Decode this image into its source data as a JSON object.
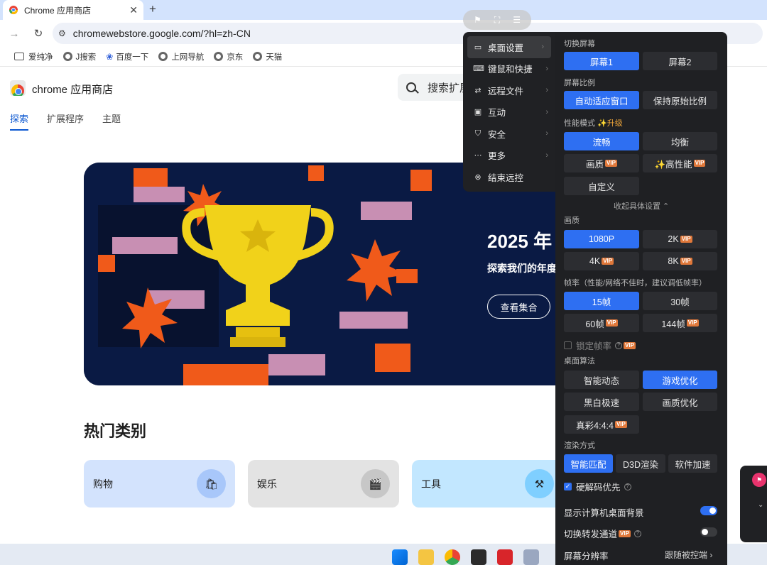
{
  "browser": {
    "tab_title": "Chrome 应用商店",
    "tab_close": "✕",
    "new_tab": "+",
    "url": "chromewebstore.google.com/?hl=zh-CN",
    "bookmarks": [
      "爱纯净",
      "J搜索",
      "百度一下",
      "上网导航",
      "京东",
      "天猫"
    ]
  },
  "store": {
    "name": "chrome 应用商店",
    "search_placeholder": "搜索扩展",
    "nav_tabs": [
      "探索",
      "扩展程序",
      "主题"
    ],
    "hero": {
      "title": "2025 年",
      "subtitle": "探索我们的年度",
      "button": "查看集合"
    },
    "categories_title": "热门类别",
    "categories": [
      {
        "label": "购物",
        "bg": "#d3e3fd",
        "icon_bg": "#a8c7fa",
        "icon": "🛍"
      },
      {
        "label": "娱乐",
        "bg": "#e3e3e3",
        "icon_bg": "#c7c7c7",
        "icon": "🎬"
      },
      {
        "label": "工具",
        "bg": "#c2e7ff",
        "icon_bg": "#7fcfff",
        "icon": "⚒"
      }
    ]
  },
  "remote_menu": {
    "items": [
      {
        "label": "桌面设置",
        "icon": "▭"
      },
      {
        "label": "键鼠和快捷",
        "icon": "⌨"
      },
      {
        "label": "远程文件",
        "icon": "⇄"
      },
      {
        "label": "互动",
        "icon": "▣"
      },
      {
        "label": "安全",
        "icon": "⛉"
      },
      {
        "label": "更多",
        "icon": "⋯"
      },
      {
        "label": "结束远控",
        "icon": "⊗"
      }
    ]
  },
  "panel": {
    "switch_screen": {
      "label": "切换屏幕",
      "options": [
        "屏幕1",
        "屏幕2"
      ],
      "selected": "屏幕1"
    },
    "ratio": {
      "label": "屏幕比例",
      "options": [
        "自动适应窗口",
        "保持原始比例"
      ],
      "selected": "自动适应窗口"
    },
    "performance": {
      "label": "性能模式",
      "upgrade": "✨升级",
      "options": [
        "流畅",
        "均衡",
        "画质",
        "✨高性能",
        "自定义"
      ],
      "selected": "流畅"
    },
    "collapse": "收起具体设置 ⌃",
    "quality": {
      "label": "画质",
      "options": [
        "1080P",
        "2K",
        "4K",
        "8K"
      ],
      "selected": "1080P"
    },
    "framerate": {
      "label": "帧率（性能/网络不佳时，建议调低帧率）",
      "options": [
        "15帧",
        "30帧",
        "60帧",
        "144帧"
      ],
      "selected": "15帧"
    },
    "lock_framerate": "锁定帧率",
    "algorithm": {
      "label": "桌面算法",
      "options": [
        "智能动态",
        "游戏优化",
        "黑白极速",
        "画质优化",
        "真彩4:4:4"
      ],
      "selected": "游戏优化"
    },
    "render": {
      "label": "渲染方式",
      "options": [
        "智能匹配",
        "D3D渲染",
        "软件加速"
      ],
      "selected": "智能匹配"
    },
    "hw_decode": "硬解码优先",
    "show_bg": "显示计算机桌面背景",
    "relay": "切换转发通道",
    "resolution_label": "屏幕分辨率",
    "resolution_value": "跟随被控端 ›",
    "vip": "VIP"
  }
}
